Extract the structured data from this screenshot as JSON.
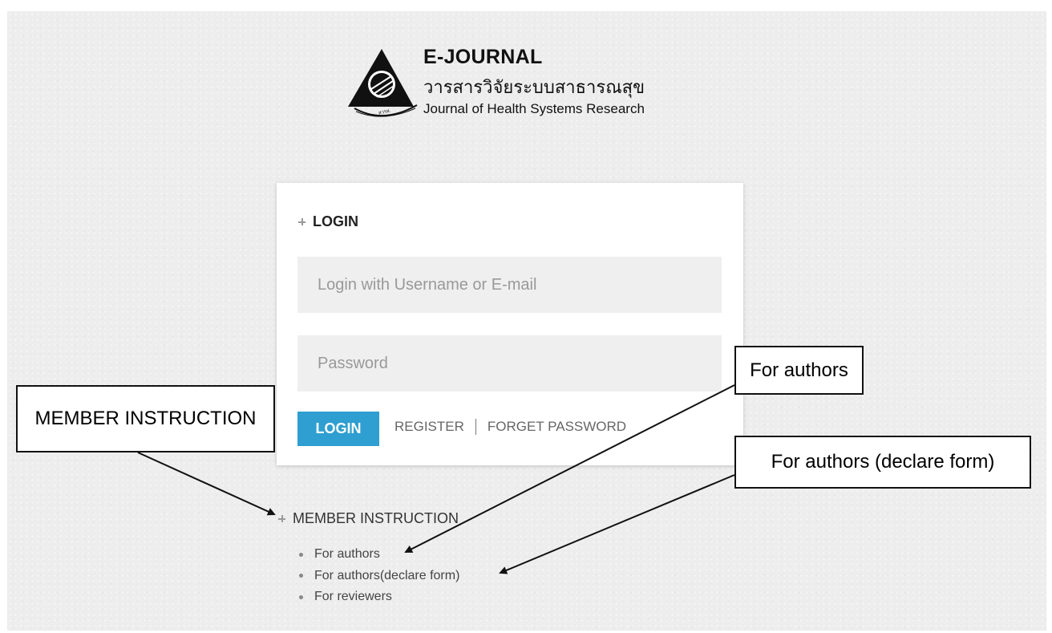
{
  "logo": {
    "title": "E-JOURNAL",
    "subtitle_thai": "วารสารวิจัยระบบสาธารณสุข",
    "subtitle_english": "Journal of Health Systems Research",
    "emblem_text": "สวรส."
  },
  "login": {
    "heading": "LOGIN",
    "username_placeholder": "Login with Username or E-mail",
    "password_placeholder": "Password",
    "login_button": "LOGIN",
    "register_link": "REGISTER",
    "forget_password_link": "FORGET PASSWORD"
  },
  "member_instruction": {
    "heading": "MEMBER INSTRUCTION",
    "items": [
      {
        "label": "For authors"
      },
      {
        "label": "For authors(declare form)"
      },
      {
        "label": "For reviewers"
      }
    ]
  },
  "annotations": {
    "member_instruction": "MEMBER INSTRUCTION",
    "for_authors": "For authors",
    "for_authors_declare": "For authors (declare form)"
  },
  "colors": {
    "page_background": "#ededed",
    "login_button": "#2e9fd0",
    "input_background": "#efefef"
  }
}
